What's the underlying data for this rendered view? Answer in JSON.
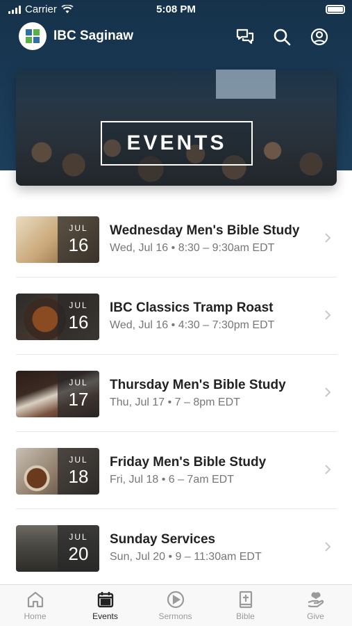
{
  "status_bar": {
    "carrier": "Carrier",
    "time": "5:08 PM"
  },
  "app": {
    "title": "IBC Saginaw"
  },
  "banner": {
    "label": "EVENTS"
  },
  "events": [
    {
      "title": "Wednesday Men's Bible Study",
      "subtitle": "Wed, Jul 16 • 8:30 – 9:30am EDT",
      "month": "JUL",
      "day": "16"
    },
    {
      "title": "IBC Classics Tramp Roast",
      "subtitle": "Wed, Jul 16 • 4:30 – 7:30pm EDT",
      "month": "JUL",
      "day": "16"
    },
    {
      "title": "Thursday Men's Bible Study",
      "subtitle": "Thu, Jul 17 • 7 – 8pm EDT",
      "month": "JUL",
      "day": "17"
    },
    {
      "title": "Friday Men's Bible Study",
      "subtitle": "Fri, Jul 18 • 6 – 7am EDT",
      "month": "JUL",
      "day": "18"
    },
    {
      "title": "Sunday Services",
      "subtitle": "Sun, Jul 20 • 9 – 11:30am EDT",
      "month": "JUL",
      "day": "20"
    }
  ],
  "tabs": [
    {
      "label": "Home",
      "icon": "home-icon"
    },
    {
      "label": "Events",
      "icon": "calendar-icon",
      "active": true
    },
    {
      "label": "Sermons",
      "icon": "play-circle-icon"
    },
    {
      "label": "Bible",
      "icon": "bible-icon"
    },
    {
      "label": "Give",
      "icon": "give-hand-icon"
    }
  ],
  "colors": {
    "header": "#16324b",
    "logo_green": "#58b047",
    "logo_blue": "#2d6fa6",
    "active_tab": "#222222",
    "inactive_tab": "#9a9a9a"
  }
}
